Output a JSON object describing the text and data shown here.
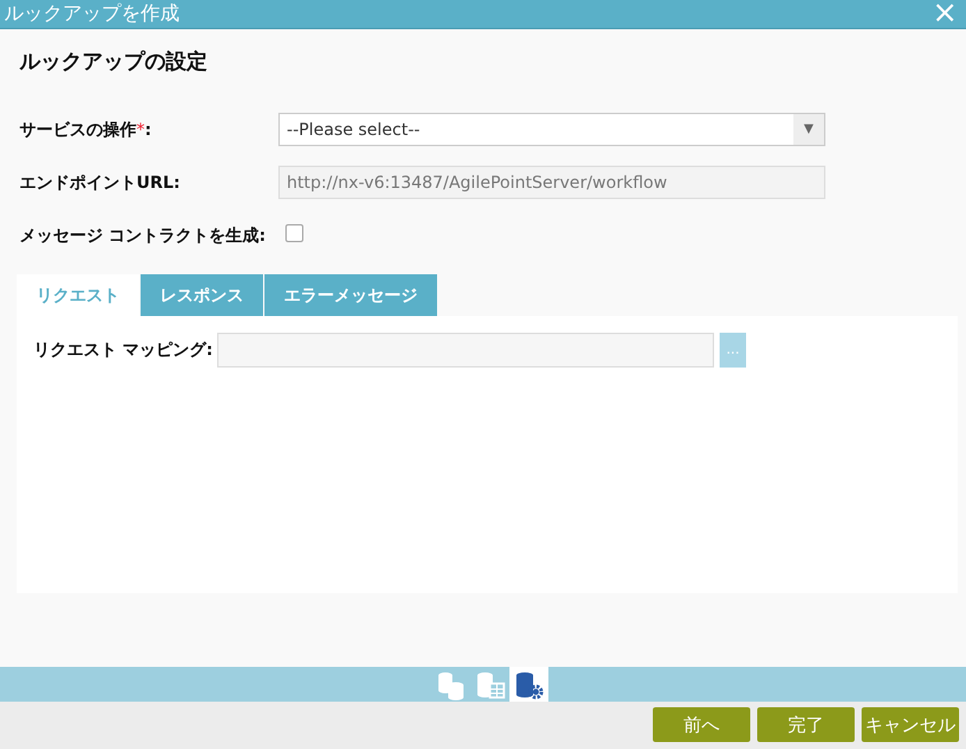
{
  "window": {
    "title": "ルックアップを作成",
    "close": "×"
  },
  "heading": "ルックアップの設定",
  "fields": [
    {
      "kind": "select",
      "label": "サービスの操作",
      "required_mark": "*",
      "suffix": ":",
      "value": "--Please select--",
      "arrow": "▼"
    },
    {
      "kind": "text",
      "label": "エンドポイントURL:",
      "value": "http://nx-v6:13487/AgilePointServer/workflow",
      "disabled": true
    },
    {
      "kind": "checkbox",
      "label": "メッセージ コントラクトを生成:",
      "checked": false
    }
  ],
  "tabs": [
    {
      "label": "リクエスト",
      "selected": true
    },
    {
      "label": "レスポンス",
      "selected": false
    },
    {
      "label": "エラーメッセージ",
      "selected": false
    }
  ],
  "mapping": {
    "label": "リクエスト マッピング:",
    "button": "..."
  },
  "steps": [
    {
      "kind": "databases",
      "selected": false
    },
    {
      "kind": "database-table",
      "selected": false
    },
    {
      "kind": "database-gear",
      "selected": true
    }
  ],
  "buttons": [
    "前へ",
    "完了",
    "キャンセル"
  ]
}
